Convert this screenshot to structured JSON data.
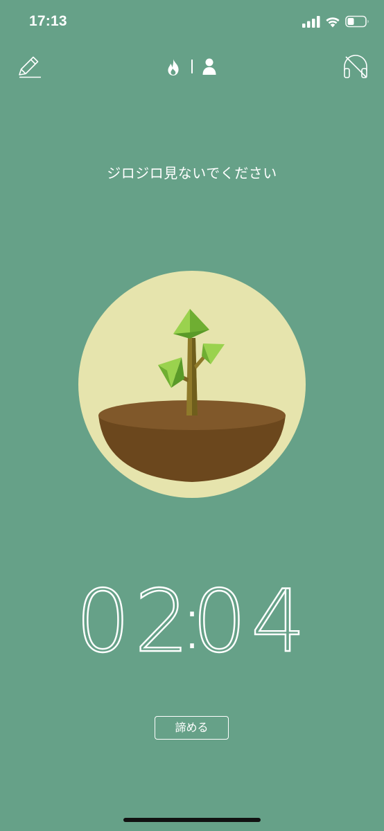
{
  "status_bar": {
    "time": "17:13",
    "icons": [
      "cellular-signal-icon",
      "wifi-icon",
      "battery-icon"
    ]
  },
  "toolbar": {
    "left_icon": "pencil-icon",
    "center_icons": [
      "fire-icon",
      "person-icon"
    ],
    "right_icon": "headphones-off-icon"
  },
  "message": "ジロジロ見ないでください",
  "plant": {
    "stage": "sapling"
  },
  "timer": {
    "minutes": "02",
    "seconds": "04",
    "separator": ":"
  },
  "give_up_button": {
    "label": "諦める"
  },
  "colors": {
    "background": "#66a188",
    "circle": "#e6e4ad",
    "soil_top": "#80582a",
    "soil_body": "#6b471d",
    "leaf": "#7cbf3e"
  }
}
